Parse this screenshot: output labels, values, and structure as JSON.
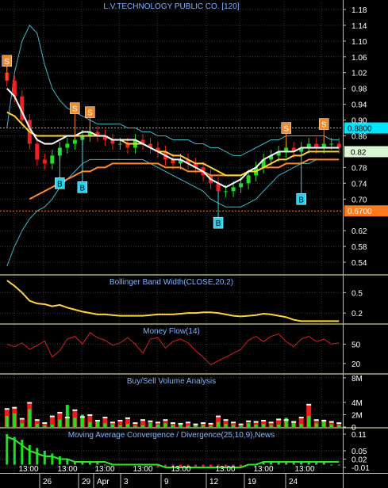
{
  "chart_data": [
    {
      "type": "candlestick",
      "title": "L.V.TECHNOLOGY PUBLIC CO. [120]",
      "ylim": [
        0.51,
        1.2
      ],
      "ticks": [
        "1.18",
        "1.14",
        "1.10",
        "1.06",
        "1.02",
        "0.98",
        "0.94",
        "0.90",
        "0.86",
        "0.82",
        "0.78",
        "0.74",
        "0.70",
        "0.66",
        "0.62",
        "0.58",
        "0.54"
      ],
      "tick_values": [
        1.18,
        1.14,
        1.1,
        1.06,
        1.02,
        0.98,
        0.94,
        0.9,
        0.86,
        0.82,
        0.78,
        0.74,
        0.7,
        0.66,
        0.62,
        0.58,
        0.54
      ],
      "reference_lines": [
        {
          "label": "0.8800",
          "value": 0.88,
          "color": "#00e5ff"
        },
        {
          "label": "0.6700",
          "value": 0.67,
          "color": "#ff7a1a"
        }
      ],
      "last_price_label": "0.82",
      "last_price": 0.82,
      "close": [
        1.0,
        0.96,
        0.9,
        0.84,
        0.8,
        0.79,
        0.81,
        0.83,
        0.84,
        0.85,
        0.86,
        0.87,
        0.86,
        0.85,
        0.84,
        0.84,
        0.83,
        0.85,
        0.84,
        0.83,
        0.82,
        0.8,
        0.79,
        0.8,
        0.79,
        0.78,
        0.76,
        0.74,
        0.72,
        0.72,
        0.73,
        0.74,
        0.76,
        0.78,
        0.8,
        0.81,
        0.82,
        0.83,
        0.82,
        0.83,
        0.84,
        0.83,
        0.84,
        0.84,
        0.83
      ],
      "ma_white": [
        0.98,
        0.96,
        0.92,
        0.88,
        0.85,
        0.84,
        0.84,
        0.85,
        0.86,
        0.86,
        0.87,
        0.87,
        0.86,
        0.86,
        0.85,
        0.85,
        0.85,
        0.85,
        0.84,
        0.83,
        0.82,
        0.81,
        0.8,
        0.8,
        0.79,
        0.78,
        0.77,
        0.75,
        0.74,
        0.73,
        0.74,
        0.75,
        0.77,
        0.78,
        0.8,
        0.81,
        0.82,
        0.82,
        0.82,
        0.83,
        0.83,
        0.83,
        0.83,
        0.83,
        0.83
      ],
      "ma_yellow": [
        0.92,
        0.91,
        0.89,
        0.87,
        0.86,
        0.86,
        0.86,
        0.86,
        0.86,
        0.86,
        0.86,
        0.86,
        0.86,
        0.86,
        0.85,
        0.85,
        0.84,
        0.84,
        0.84,
        0.83,
        0.82,
        0.82,
        0.81,
        0.81,
        0.8,
        0.79,
        0.79,
        0.78,
        0.77,
        0.76,
        0.76,
        0.76,
        0.77,
        0.77,
        0.78,
        0.79,
        0.8,
        0.8,
        0.81,
        0.81,
        0.82,
        0.82,
        0.82,
        0.82,
        0.82
      ],
      "ma_orange": [
        null,
        null,
        null,
        0.7,
        0.71,
        0.72,
        0.73,
        0.74,
        0.75,
        0.76,
        0.77,
        0.77,
        0.78,
        0.78,
        0.79,
        0.79,
        0.79,
        0.79,
        0.79,
        0.79,
        0.79,
        0.78,
        0.78,
        0.78,
        0.77,
        0.77,
        0.77,
        0.76,
        0.76,
        0.76,
        0.76,
        0.76,
        0.77,
        0.77,
        0.78,
        0.78,
        0.78,
        0.79,
        0.79,
        0.79,
        0.8,
        0.8,
        0.8,
        0.8,
        0.8
      ],
      "bb_upper": [
        0.88,
        1.02,
        1.1,
        1.14,
        1.12,
        1.04,
        0.98,
        0.95,
        0.93,
        0.92,
        0.91,
        0.9,
        0.89,
        0.89,
        0.89,
        0.89,
        0.88,
        0.88,
        0.87,
        0.87,
        0.86,
        0.86,
        0.85,
        0.85,
        0.85,
        0.84,
        0.84,
        0.83,
        0.83,
        0.82,
        0.81,
        0.81,
        0.82,
        0.83,
        0.84,
        0.85,
        0.85,
        0.86,
        0.86,
        0.86,
        0.86,
        0.86,
        0.86,
        0.85,
        0.85
      ],
      "bb_lower": [
        0.53,
        0.58,
        0.62,
        0.65,
        0.67,
        0.68,
        0.7,
        0.73,
        0.75,
        0.77,
        0.79,
        0.8,
        0.8,
        0.8,
        0.8,
        0.8,
        0.8,
        0.8,
        0.8,
        0.79,
        0.78,
        0.77,
        0.76,
        0.75,
        0.74,
        0.73,
        0.72,
        0.7,
        0.69,
        0.68,
        0.68,
        0.68,
        0.69,
        0.7,
        0.72,
        0.74,
        0.76,
        0.77,
        0.78,
        0.79,
        0.79,
        0.8,
        0.8,
        0.8,
        0.8
      ],
      "signals": [
        {
          "label": "S",
          "i": 0,
          "price": 1.05
        },
        {
          "label": "S",
          "i": 9,
          "price": 0.93
        },
        {
          "label": "S",
          "i": 11,
          "price": 0.92
        },
        {
          "label": "S",
          "i": 37,
          "price": 0.88
        },
        {
          "label": "S",
          "i": 42,
          "price": 0.89
        },
        {
          "label": "B",
          "i": 7,
          "price": 0.74
        },
        {
          "label": "B",
          "i": 10,
          "price": 0.73
        },
        {
          "label": "B",
          "i": 28,
          "price": 0.64
        },
        {
          "label": "B",
          "i": 39,
          "price": 0.7
        }
      ]
    },
    {
      "type": "line",
      "title": "Bollinger Band Width(CLOSE,20,2)",
      "ylim": [
        0.05,
        0.75
      ],
      "ticks": [
        "0.5",
        "0.2"
      ],
      "tick_values": [
        0.5,
        0.2
      ],
      "values": [
        0.68,
        0.6,
        0.5,
        0.38,
        0.34,
        0.33,
        0.3,
        0.32,
        0.28,
        0.25,
        0.22,
        0.2,
        0.18,
        0.18,
        0.17,
        0.16,
        0.16,
        0.16,
        0.16,
        0.17,
        0.18,
        0.18,
        0.18,
        0.19,
        0.2,
        0.2,
        0.21,
        0.21,
        0.2,
        0.18,
        0.16,
        0.15,
        0.16,
        0.17,
        0.19,
        0.18,
        0.16,
        0.14,
        0.1,
        0.08,
        0.08,
        0.08,
        0.08,
        0.08,
        0.08
      ]
    },
    {
      "type": "line",
      "title": "Money Flow(14)",
      "ylim": [
        5,
        80
      ],
      "ticks": [
        "50",
        "20"
      ],
      "tick_values": [
        50,
        20
      ],
      "values": [
        50,
        46,
        52,
        42,
        48,
        55,
        30,
        40,
        58,
        62,
        50,
        68,
        60,
        56,
        48,
        52,
        60,
        50,
        36,
        58,
        60,
        44,
        54,
        58,
        52,
        40,
        30,
        18,
        24,
        30,
        36,
        42,
        56,
        62,
        54,
        62,
        66,
        54,
        46,
        58,
        62,
        54,
        58,
        50,
        52
      ]
    },
    {
      "type": "bar",
      "title": "Buy/Sell Volume Analysis",
      "ylim": [
        0,
        8.5
      ],
      "ticks": [
        "8M",
        "4M",
        "2M",
        "0"
      ],
      "tick_values": [
        8,
        4,
        2,
        0
      ],
      "buy": [
        1.8,
        2.2,
        0.6,
        2.9,
        0.5,
        0.2,
        0.4,
        1.2,
        3.6,
        1.5,
        2.0,
        0.8,
        1.1,
        0.6,
        0.4,
        0.3,
        0.5,
        0.2,
        0.3,
        0.7,
        0.4,
        0.6,
        0.3,
        0.5,
        0.2,
        0.4,
        0.3,
        0.2,
        0.8,
        0.5,
        0.3,
        0.2,
        0.6,
        0.4,
        0.5,
        0.3,
        0.4,
        1.5,
        0.8,
        0.5,
        1.8,
        0.6,
        1.2,
        0.4,
        0.3
      ],
      "sell": [
        2.8,
        3.0,
        1.2,
        3.8,
        1.0,
        0.5,
        1.6,
        2.2,
        1.4,
        2.6,
        1.5,
        1.8,
        0.9,
        1.4,
        0.6,
        0.9,
        1.3,
        0.5,
        1.0,
        0.8,
        0.6,
        1.0,
        0.5,
        0.4,
        0.6,
        0.3,
        0.5,
        0.4,
        1.6,
        1.0,
        0.6,
        0.3,
        0.8,
        0.7,
        0.9,
        0.6,
        1.1,
        1.0,
        0.7,
        1.4,
        3.5,
        1.0,
        0.9,
        0.7,
        0.5
      ]
    },
    {
      "type": "bar",
      "title": "Moving Average Convergence / Divergence(25,10,9),News",
      "ylim": [
        -0.03,
        0.13
      ],
      "ticks": [
        "0.11",
        "0.05",
        "0.02",
        "-0.01"
      ],
      "tick_values": [
        0.11,
        0.05,
        0.02,
        -0.01
      ],
      "histogram": [
        0.11,
        0.1,
        0.09,
        0.07,
        0.06,
        0.05,
        0.04,
        0.03,
        0.02,
        0.01,
        0.01,
        0.01,
        0.01,
        0.0,
        0.0,
        0.0,
        0.0,
        0.0,
        0.0,
        0.0,
        -0.01,
        -0.01,
        -0.01,
        -0.01,
        -0.01,
        -0.01,
        -0.01,
        -0.01,
        -0.01,
        -0.01,
        -0.01,
        -0.01,
        0.0,
        0.0,
        0.01,
        0.01,
        0.01,
        0.01,
        0.01,
        0.01,
        0.01,
        0.01,
        0.01,
        0.0,
        0.0
      ],
      "macd": [
        0.1,
        0.09,
        0.07,
        0.05,
        0.04,
        0.03,
        0.03,
        0.02,
        0.02,
        0.01,
        0.01,
        0.01,
        0.01,
        0.01,
        0.0,
        0.0,
        0.0,
        0.0,
        0.0,
        0.0,
        0.0,
        -0.01,
        -0.01,
        -0.01,
        -0.01,
        -0.01,
        -0.01,
        -0.01,
        -0.01,
        -0.01,
        -0.01,
        -0.01,
        0.0,
        0.0,
        0.01,
        0.01,
        0.01,
        0.01,
        0.01,
        0.01,
        0.01,
        0.01,
        0.01,
        0.01,
        0.01
      ]
    }
  ],
  "x_axis": {
    "time_labels": [
      "13:00",
      "13:00",
      "13:00",
      "13:00",
      "13:00",
      "13:00",
      "13:00",
      "13:00"
    ],
    "date_labels": [
      "26",
      "29",
      "Apr",
      "3",
      "9",
      "12",
      "19",
      "24"
    ]
  }
}
